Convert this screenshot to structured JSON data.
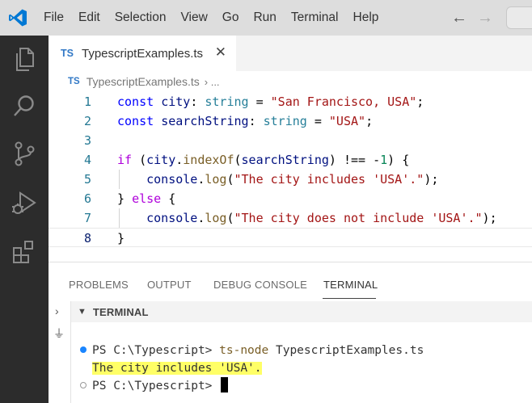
{
  "colors": {
    "titlebar_bg": "#dddddd",
    "activitybar_bg": "#2c2c2c",
    "vscode_blue": "#0078d4",
    "ts_blue": "#3178c6",
    "highlight": "#ffff66"
  },
  "menu": {
    "items": [
      "File",
      "Edit",
      "Selection",
      "View",
      "Go",
      "Run",
      "Terminal",
      "Help"
    ]
  },
  "titlebar": {
    "back_icon": "arrow-left-icon",
    "forward_icon": "arrow-right-icon"
  },
  "activitybar": {
    "icons": [
      "explorer-icon",
      "search-icon",
      "source-control-icon",
      "run-debug-icon",
      "extensions-icon"
    ]
  },
  "editor": {
    "tab": {
      "badge": "TS",
      "label": "TypescriptExamples.ts",
      "close": "✕"
    },
    "breadcrumb": {
      "badge": "TS",
      "file": "TypescriptExamples.ts",
      "sep": "› ..."
    },
    "lines": [
      {
        "num": "1",
        "tokens": [
          {
            "t": "const",
            "c": "kw"
          },
          {
            "t": " ",
            "c": "pun"
          },
          {
            "t": "city",
            "c": "var"
          },
          {
            "t": ": ",
            "c": "pun"
          },
          {
            "t": "string",
            "c": "typ"
          },
          {
            "t": " = ",
            "c": "pun"
          },
          {
            "t": "\"San Francisco, USA\"",
            "c": "str"
          },
          {
            "t": ";",
            "c": "pun"
          }
        ]
      },
      {
        "num": "2",
        "tokens": [
          {
            "t": "const",
            "c": "kw"
          },
          {
            "t": " ",
            "c": "pun"
          },
          {
            "t": "searchString",
            "c": "var"
          },
          {
            "t": ": ",
            "c": "pun"
          },
          {
            "t": "string",
            "c": "typ"
          },
          {
            "t": " = ",
            "c": "pun"
          },
          {
            "t": "\"USA\"",
            "c": "str"
          },
          {
            "t": ";",
            "c": "pun"
          }
        ]
      },
      {
        "num": "3",
        "tokens": []
      },
      {
        "num": "4",
        "tokens": [
          {
            "t": "if",
            "c": "kw2"
          },
          {
            "t": " (",
            "c": "pun"
          },
          {
            "t": "city",
            "c": "var"
          },
          {
            "t": ".",
            "c": "pun"
          },
          {
            "t": "indexOf",
            "c": "fn"
          },
          {
            "t": "(",
            "c": "pun"
          },
          {
            "t": "searchString",
            "c": "var"
          },
          {
            "t": ") !== -",
            "c": "pun"
          },
          {
            "t": "1",
            "c": "num"
          },
          {
            "t": ") {",
            "c": "pun"
          }
        ]
      },
      {
        "num": "5",
        "guide": true,
        "tokens": [
          {
            "t": "    ",
            "c": "pun"
          },
          {
            "t": "console",
            "c": "var"
          },
          {
            "t": ".",
            "c": "pun"
          },
          {
            "t": "log",
            "c": "fn"
          },
          {
            "t": "(",
            "c": "pun"
          },
          {
            "t": "\"The city includes 'USA'.\"",
            "c": "str"
          },
          {
            "t": ");",
            "c": "pun"
          }
        ]
      },
      {
        "num": "6",
        "tokens": [
          {
            "t": "} ",
            "c": "pun"
          },
          {
            "t": "else",
            "c": "kw2"
          },
          {
            "t": " {",
            "c": "pun"
          }
        ]
      },
      {
        "num": "7",
        "guide": true,
        "tokens": [
          {
            "t": "    ",
            "c": "pun"
          },
          {
            "t": "console",
            "c": "var"
          },
          {
            "t": ".",
            "c": "pun"
          },
          {
            "t": "log",
            "c": "fn"
          },
          {
            "t": "(",
            "c": "pun"
          },
          {
            "t": "\"The city does not include 'USA'.\"",
            "c": "str"
          },
          {
            "t": ");",
            "c": "pun"
          }
        ]
      },
      {
        "num": "8",
        "active": true,
        "tokens": [
          {
            "t": "}",
            "c": "pun"
          }
        ]
      }
    ]
  },
  "panel": {
    "tabs": [
      "PROBLEMS",
      "OUTPUT",
      "DEBUG CONSOLE",
      "TERMINAL"
    ],
    "active_tab": "TERMINAL",
    "terminal_header": "TERMINAL",
    "side_icons": [
      "chevron-right-icon",
      "plug-icon"
    ],
    "terminal": {
      "prompt1": "PS C:\\Typescript> ",
      "command": "ts-node",
      "args": " TypescriptExamples.ts",
      "output": "The city includes 'USA'.",
      "prompt2": "PS C:\\Typescript> "
    }
  }
}
